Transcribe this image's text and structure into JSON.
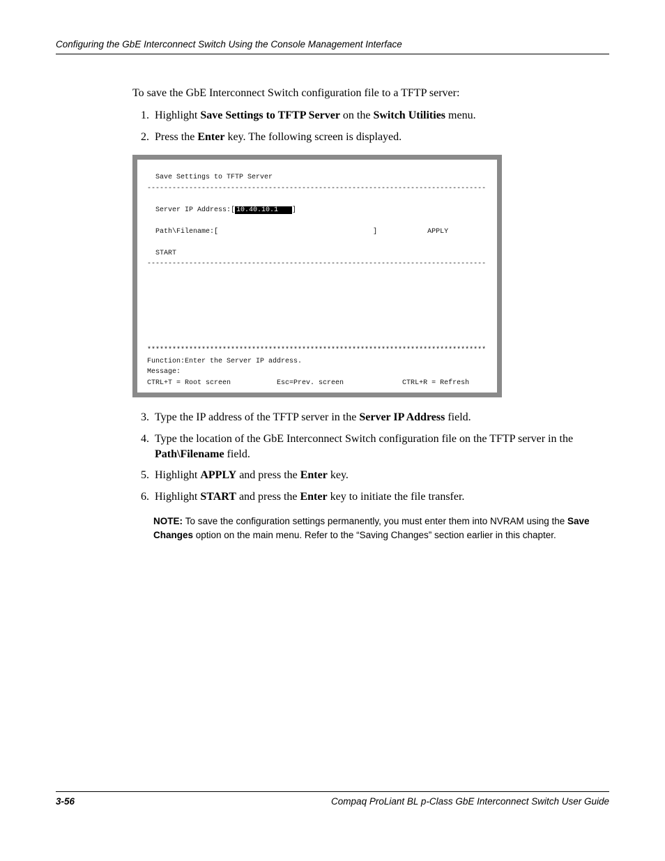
{
  "header": {
    "title": "Configuring the GbE Interconnect Switch Using the Console Management Interface"
  },
  "intro": {
    "lead_1": "To save the GbE Interconnect Switch configuration file to a TFTP server:",
    "step1_pre": "Highlight ",
    "step1_b1": "Save Settings to TFTP Server",
    "step1_mid": " on the ",
    "step1_b2": "Switch Utilities",
    "step1_post": " menu.",
    "step2_pre": "Press the ",
    "step2_b1": "Enter",
    "step2_post": " key. The following screen is displayed."
  },
  "screen": {
    "title": "  Save Settings to TFTP Server",
    "dashline": "---------------------------------------------------------------------------------",
    "ip_label": "  Server IP Address:[",
    "ip_value": "10.40.10.1   ",
    "ip_close": "]",
    "path_label_left": "  Path\\Filename:[",
    "path_label_right": "]",
    "apply": "APPLY",
    "start": "  START",
    "starline": "*********************************************************************************",
    "func": "Function:Enter the Server IP address.",
    "msg": "Message:",
    "help": "CTRL+T = Root screen           Esc=Prev. screen              CTRL+R = Refresh"
  },
  "after": {
    "s3_pre": "Type the IP address of the TFTP server in the ",
    "s3_b1": "Server IP Address",
    "s3_post": " field.",
    "s4_pre": "Type the location of the GbE Interconnect Switch configuration file on the TFTP server in the ",
    "s4_b1": "Path\\Filename",
    "s4_post": " field.",
    "s5_pre": "Highlight ",
    "s5_b1": "APPLY",
    "s5_mid": " and press the ",
    "s5_b2": "Enter",
    "s5_post": " key.",
    "s6_pre": "Highlight ",
    "s6_b1": "START",
    "s6_mid": " and press the ",
    "s6_b2": "Enter",
    "s6_post": " key to initiate the file transfer."
  },
  "note": {
    "label": "NOTE:  ",
    "pre": "To save the configuration settings permanently, you must enter them into NVRAM using the ",
    "b1": "Save Changes",
    "post": " option on the main menu. Refer to the “Saving Changes” section earlier in this chapter."
  },
  "footer": {
    "page": "3-56",
    "guide": "Compaq ProLiant BL p-Class GbE Interconnect Switch User Guide"
  }
}
